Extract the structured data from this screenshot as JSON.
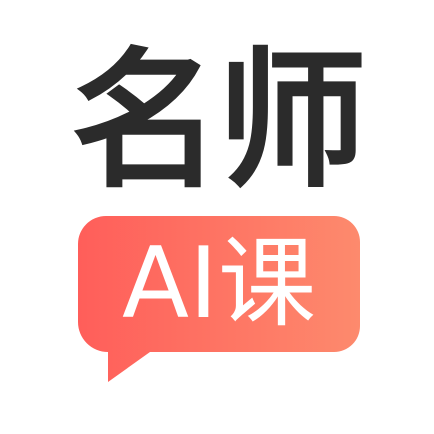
{
  "logo": {
    "title": "名师",
    "badge_text": "AI课",
    "colors": {
      "background": "#ffffff",
      "title": "#2b2b2b",
      "badge_gradient_start": "#ff5e5a",
      "badge_gradient_end": "#fd8a6d",
      "badge_text": "#ffffff"
    }
  }
}
